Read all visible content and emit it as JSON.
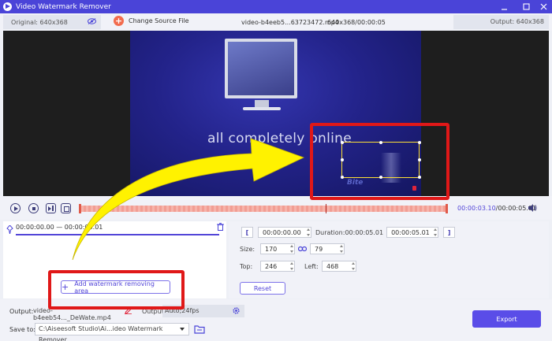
{
  "window": {
    "title": "Video Watermark Remover",
    "minimize_icon": "minimize-icon",
    "maximize_icon": "maximize-icon",
    "close_icon": "close-icon",
    "accent_color": "#4a44d8"
  },
  "infobar": {
    "original": "Original: 640x368",
    "change_source": "Change Source File",
    "file_name": "video-b4eeb5...63723472.mp4",
    "file_meta": "640x368/00:00:05",
    "output": "Output: 640x368"
  },
  "video": {
    "caption": "all completely online",
    "watermark_text": "Bite"
  },
  "playback": {
    "current_time": "00:00:03.10",
    "total_time": "/00:00:05.01"
  },
  "segment": {
    "range": "00:00:00.00 — 00:00:05.01",
    "add_area_label": "Add watermark removing area"
  },
  "settings": {
    "start_time": "00:00:00.00",
    "duration_label": "Duration:00:00:05.01",
    "end_time": "00:00:05.01",
    "size_label": "Size:",
    "size_w": "170",
    "size_h": "79",
    "top_label": "Top:",
    "top_value": "246",
    "left_label": "Left:",
    "left_value": "468",
    "reset_label": "Reset"
  },
  "bottom": {
    "output_label": "Output:",
    "output_file": "video-b4eeb54..._DeWate.mp4",
    "output_label2": "Output:",
    "output_format": "Auto;24fps",
    "save_label": "Save to:",
    "save_path": "C:\\Aiseesoft Studio\\Ai...ideo Watermark Remover",
    "export_label": "Export",
    "export_color": "#5a4de8"
  }
}
